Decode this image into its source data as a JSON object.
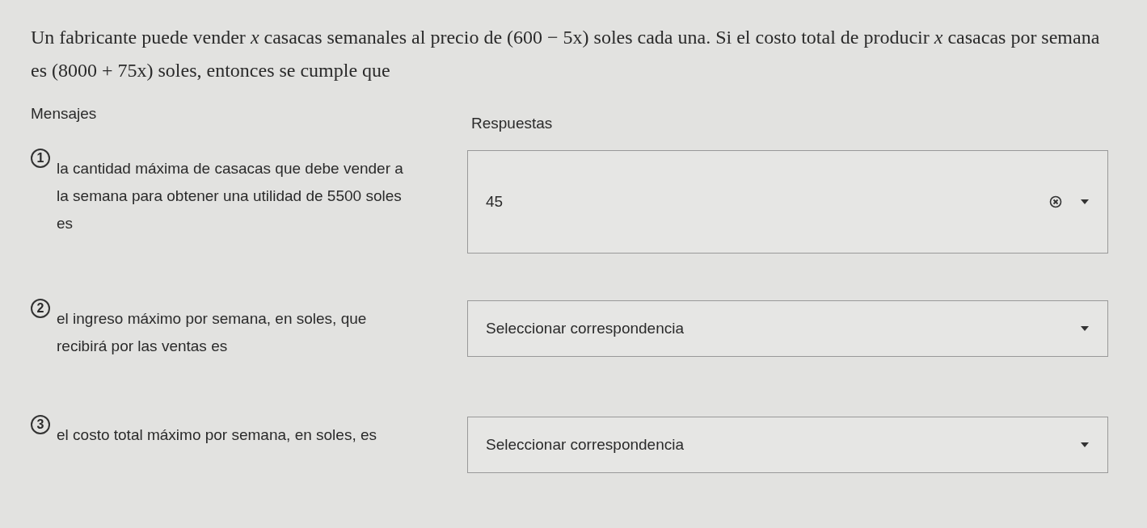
{
  "question": "Un fabricante puede vender *x* casacas semanales al precio de (600 − 5x) soles cada una. Si el costo total de producir *x* casacas por semana es (8000 + 75x) soles, entonces se cumple que",
  "headers": {
    "messages": "Mensajes",
    "answers": "Respuestas"
  },
  "items": [
    {
      "number": "1",
      "message": "la cantidad máxima de casacas que debe vender a la semana para obtener una utilidad de 5500 soles es",
      "answer": {
        "value": "45",
        "clearable": true
      }
    },
    {
      "number": "2",
      "message": "el ingreso máximo por semana, en soles, que recibirá por las ventas es",
      "answer": {
        "placeholder": "Seleccionar correspondencia",
        "clearable": false
      }
    },
    {
      "number": "3",
      "message": "el costo total máximo por semana, en soles, es",
      "answer": {
        "placeholder": "Seleccionar correspondencia",
        "clearable": false
      }
    }
  ]
}
